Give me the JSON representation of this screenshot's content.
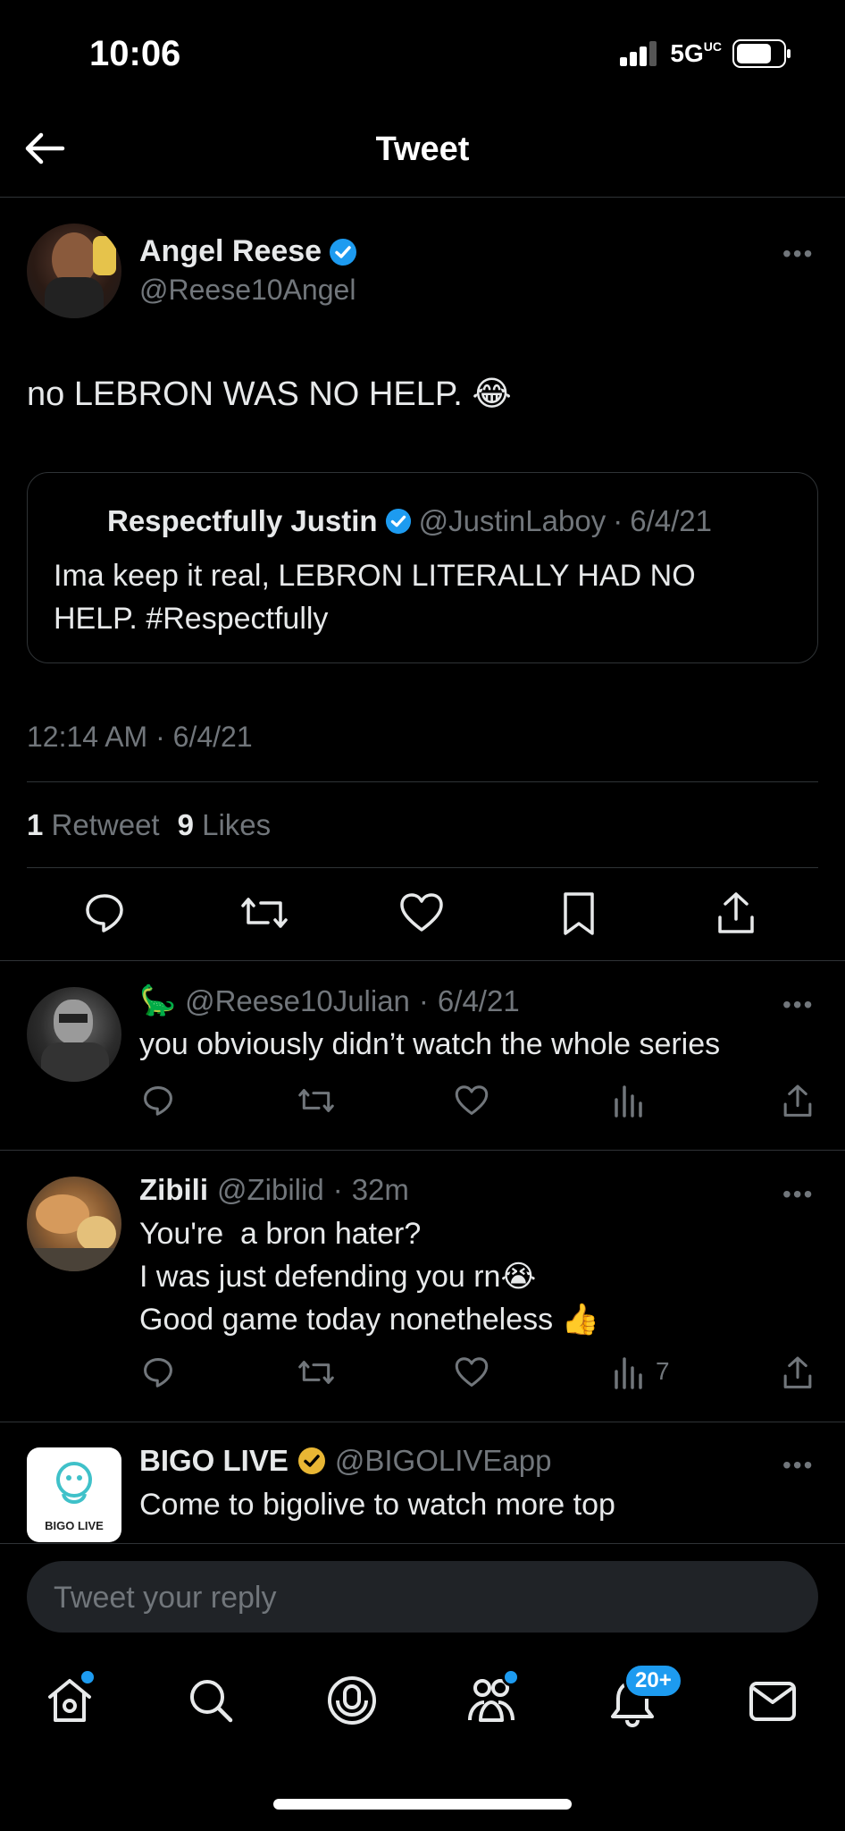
{
  "status": {
    "time": "10:06",
    "network": "5G",
    "network_sub": "UC"
  },
  "header": {
    "title": "Tweet"
  },
  "tweet": {
    "author_name": "Angel Reese",
    "author_handle": "@Reese10Angel",
    "text": "no LEBRON WAS NO HELP. 😂",
    "quote": {
      "author_name": "Respectfully Justin",
      "author_handle": "@JustinLaboy",
      "date": "6/4/21",
      "line1": "Ima keep it real, LEBRON LITERALLY HAD NO",
      "line2": "HELP. #Respectfully"
    },
    "timestamp": "12:14 AM · 6/4/21",
    "retweet_count": "1",
    "retweet_label": "Retweet",
    "like_count": "9",
    "like_label": "Likes"
  },
  "replies": [
    {
      "emoji": "🦕",
      "name": "",
      "handle": "@Reese10Julian",
      "time": "6/4/21",
      "lines": [
        "you obviously didn’t watch the whole series"
      ],
      "views": ""
    },
    {
      "name": "Zibili",
      "handle": "@Zibilid",
      "time": "32m",
      "lines": [
        "You're  a bron hater?",
        "I was just defending you rn😭",
        "Good game today nonetheless 👍"
      ],
      "views": "7"
    },
    {
      "name": "BIGO LIVE",
      "handle": "@BIGOLIVEapp",
      "text": "Come to bigolive to watch more top",
      "logo_text": "BIGO LIVE"
    }
  ],
  "reply_box": {
    "placeholder": "Tweet your reply"
  },
  "tabbar": {
    "notif_badge": "20+"
  },
  "colors": {
    "accent": "#1d9bf0",
    "verified_gold": "#e8b634",
    "muted": "#71767b",
    "bg": "#000000"
  }
}
